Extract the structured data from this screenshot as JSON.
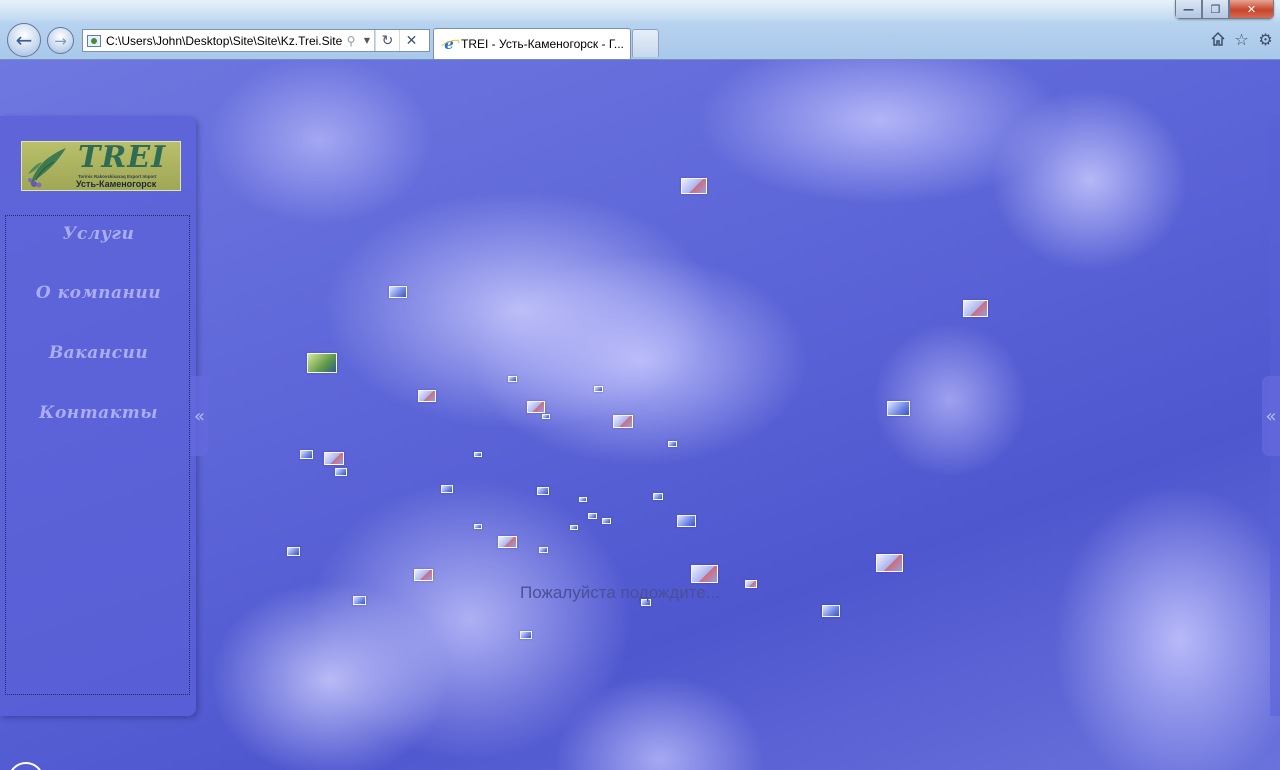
{
  "browser": {
    "window_controls": {
      "minimize": "—",
      "maximize": "❐",
      "close": "✕"
    },
    "back_icon": "back-arrow-icon",
    "forward_icon": "forward-arrow-icon",
    "address": "C:\\Users\\John\\Desktop\\Site\\Site\\Kz.Trei.Site",
    "tab_title": "TREI - Усть-Каменогорск - Г...",
    "toolbar_icons": [
      "home-icon",
      "star-icon",
      "gear-icon"
    ]
  },
  "page": {
    "logo": {
      "title": "TREI",
      "subtitle": "Torinis Rakovskisaraq Export Import",
      "city": "Усть-Каменогорск"
    },
    "menu": [
      {
        "label": "Услуги"
      },
      {
        "label": "О компании"
      },
      {
        "label": "Вакансии"
      },
      {
        "label": "Контакты"
      }
    ],
    "collapse_glyph": "«",
    "loading_text": "Пожалуйста подождите..."
  }
}
